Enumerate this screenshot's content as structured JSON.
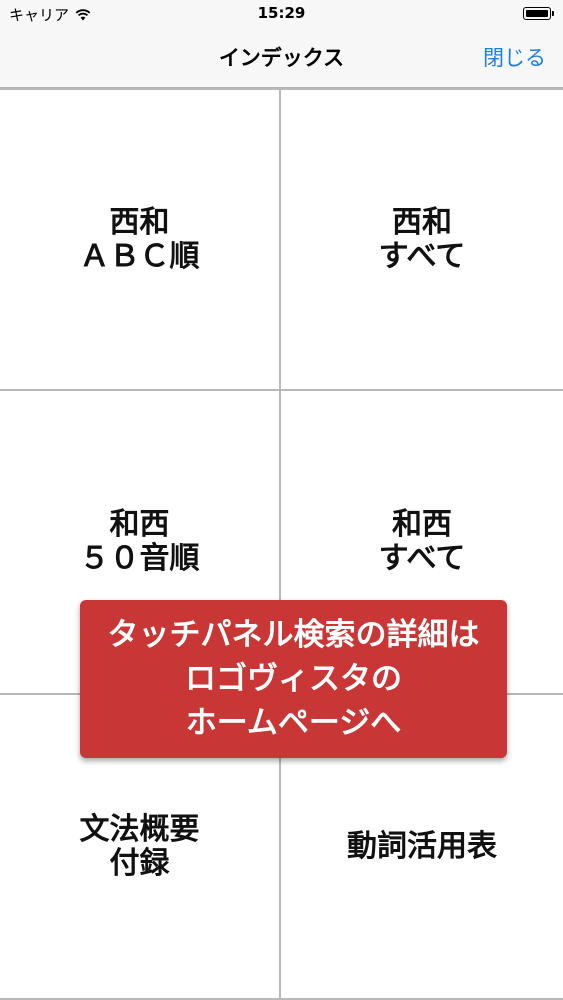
{
  "status_bar": {
    "carrier": "キャリア",
    "time": "15:29",
    "wifi_icon": "wifi-icon",
    "battery_icon": "battery-icon"
  },
  "nav": {
    "title": "インデックス",
    "close_label": "閉じる",
    "accent_color": "#1a7fe0"
  },
  "grid": {
    "items": [
      {
        "label": "西和\nＡＢＣ順"
      },
      {
        "label": "西和\nすべて"
      },
      {
        "label": "和西\n５０音順"
      },
      {
        "label": "和西\nすべて"
      },
      {
        "label": "文法概要\n付録"
      },
      {
        "label": "動詞活用表"
      }
    ]
  },
  "banner": {
    "text": "タッチパネル検索の詳細は\nロゴヴィスタの\nホームページへ",
    "color": "#c93636"
  }
}
